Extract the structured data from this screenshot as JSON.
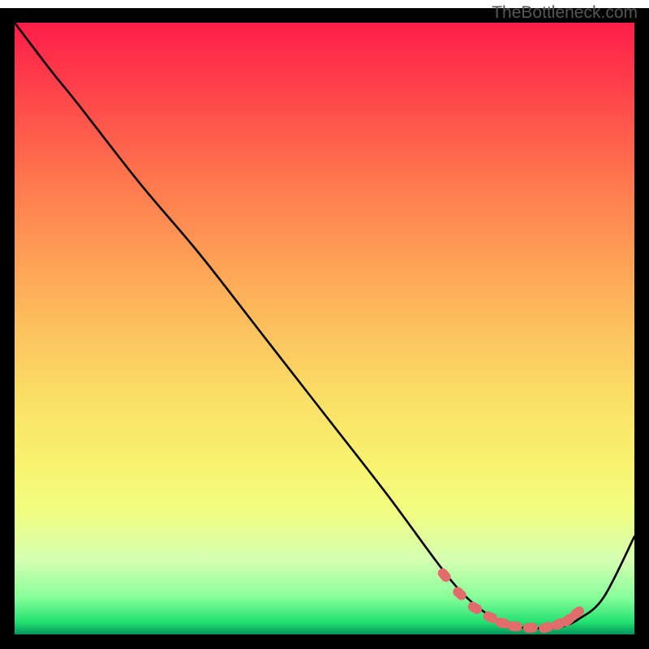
{
  "attribution": "TheBottleneck.com",
  "chart_data": {
    "type": "line",
    "title": "",
    "xlabel": "",
    "ylabel": "",
    "xlim": [
      0,
      100
    ],
    "ylim": [
      0,
      100
    ],
    "series": [
      {
        "name": "curve",
        "x": [
          0,
          6,
          10,
          20,
          30,
          40,
          50,
          60,
          68,
          72,
          76,
          80,
          84,
          88,
          91,
          95,
          100
        ],
        "y": [
          100,
          92,
          87,
          74,
          62,
          49,
          36,
          23,
          12,
          7,
          3.5,
          1.5,
          1,
          1.2,
          2.5,
          6,
          16
        ]
      }
    ],
    "markers": {
      "name": "dots",
      "color": "#e26b6b",
      "x": [
        69.5,
        72,
        74.5,
        77,
        79,
        81,
        83.5,
        86,
        88,
        89.5,
        91
      ],
      "y": [
        9.5,
        6.5,
        4.2,
        2.7,
        1.8,
        1.3,
        1.1,
        1.2,
        1.8,
        2.5,
        3.7
      ]
    }
  }
}
